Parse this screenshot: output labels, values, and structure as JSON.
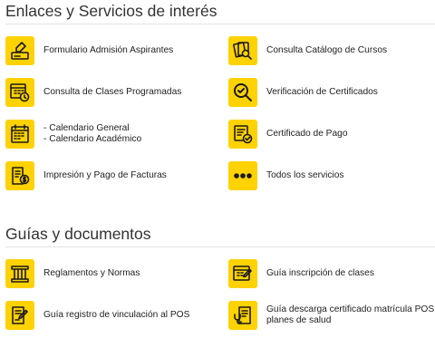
{
  "sections": [
    {
      "title": "Enlaces y Servicios de interés",
      "items": [
        {
          "label": "Formulario Admisión Aspirantes",
          "icon": "form-signature-icon"
        },
        {
          "label": "Consulta Catálogo de Cursos",
          "icon": "catalog-search-icon"
        },
        {
          "label": "Consulta de Clases Programadas",
          "icon": "calendar-clock-icon"
        },
        {
          "label": "Verificación de Certificados",
          "icon": "magnifier-check-icon"
        },
        {
          "lines": [
            "- Calendario General",
            "- Calendario Académico"
          ],
          "icon": "calendar-grid-icon"
        },
        {
          "label": "Certificado de Pago",
          "icon": "payment-certificate-icon"
        },
        {
          "label": "Impresión y Pago de Facturas",
          "icon": "invoice-payment-icon"
        },
        {
          "label": "Todos los servicios",
          "icon": "more-dots-icon"
        }
      ]
    },
    {
      "title": "Guías y documentos",
      "items": [
        {
          "label": "Reglamentos y Normas",
          "icon": "column-building-icon"
        },
        {
          "label": "Guía inscripción de clases",
          "icon": "calendar-pen-icon"
        },
        {
          "label": "Guía registro de vinculación al POS",
          "icon": "document-pen-icon"
        },
        {
          "lines": [
            "Guía descarga certificado matrícula POS y",
            "planes de salud"
          ],
          "icon": "health-certificate-icon"
        }
      ]
    }
  ],
  "colors": {
    "icon_background": "#ffd200",
    "icon_foreground": "#1a1a1a",
    "rule": "#e2e2e2"
  }
}
